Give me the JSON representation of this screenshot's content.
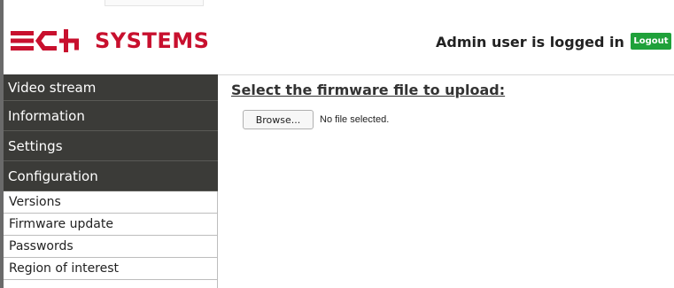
{
  "header": {
    "logo_text": "SYSTEMS",
    "login_message": "Admin user is logged in",
    "logout_label": "Logout"
  },
  "sidebar": {
    "items": [
      {
        "label": "Video stream"
      },
      {
        "label": "Information"
      },
      {
        "label": "Settings"
      },
      {
        "label": "Configuration"
      }
    ],
    "subitems": [
      {
        "label": "Versions"
      },
      {
        "label": "Firmware update"
      },
      {
        "label": "Passwords"
      },
      {
        "label": "Region of interest"
      }
    ]
  },
  "main": {
    "title": "Select the firmware file to upload:",
    "browse_label": "Browse...",
    "file_status": "No file selected."
  },
  "colors": {
    "brand": "#c8102e",
    "nav_bg": "#3b3b38",
    "logout_bg": "#1fa13a"
  }
}
